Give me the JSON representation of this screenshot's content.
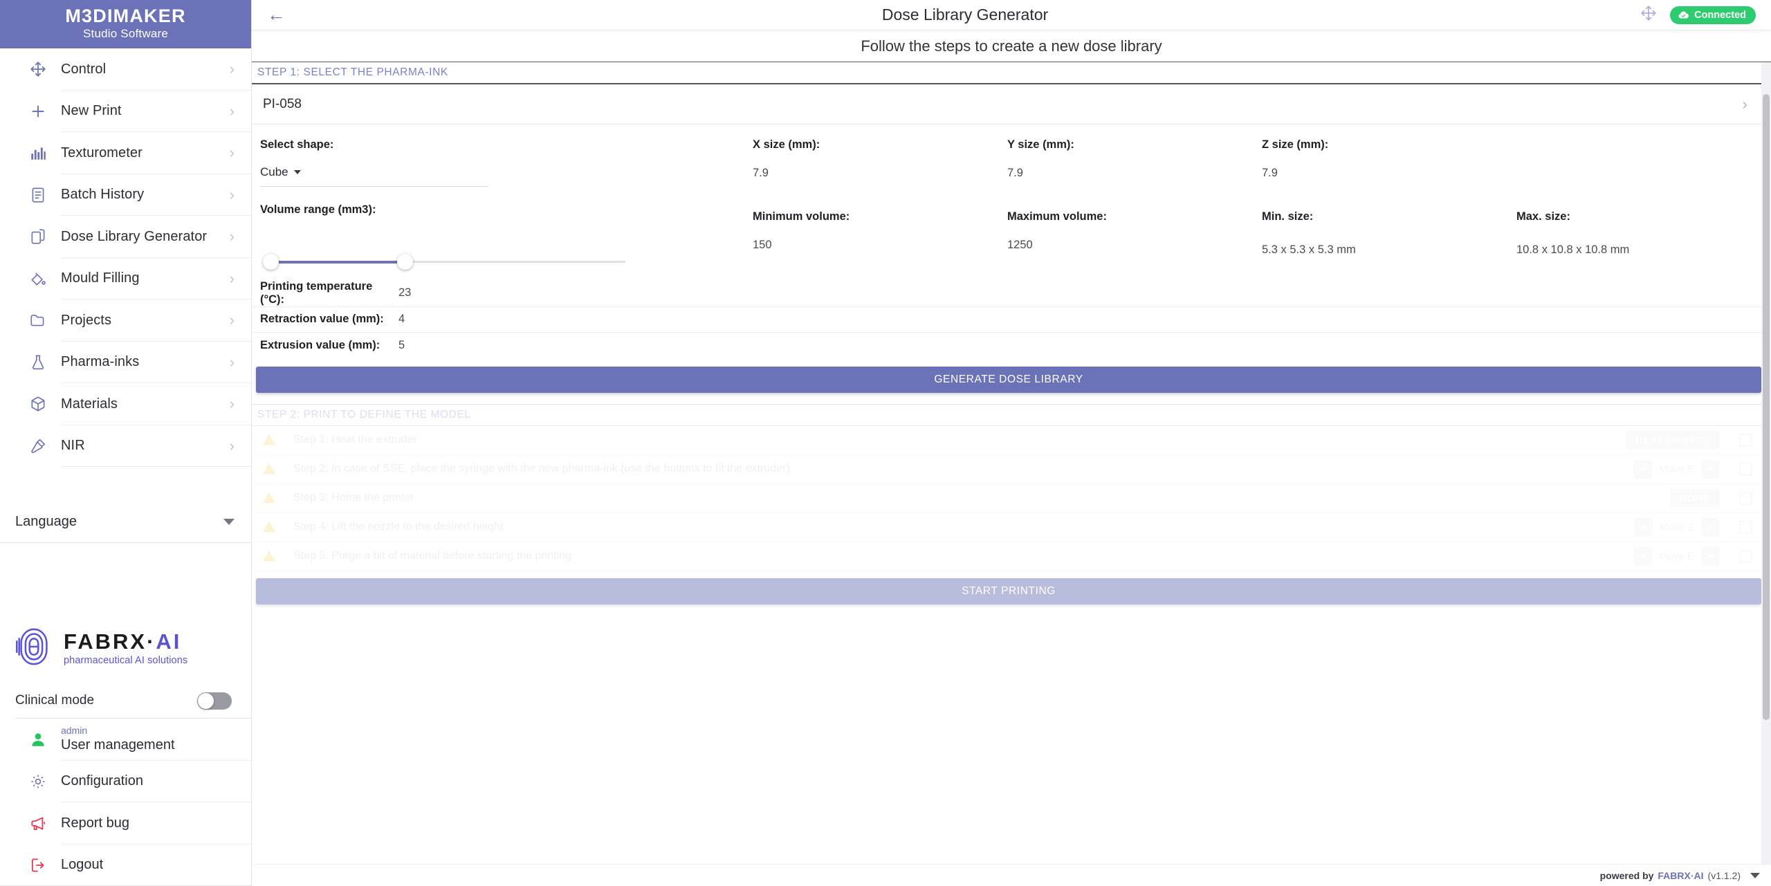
{
  "brand": {
    "title": "M3DIMAKER",
    "subtitle": "Studio Software"
  },
  "sidebar": {
    "items": [
      {
        "label": "Control",
        "icon": "move-icon"
      },
      {
        "label": "New Print",
        "icon": "plus-icon"
      },
      {
        "label": "Texturometer",
        "icon": "bar-chart-icon"
      },
      {
        "label": "Batch History",
        "icon": "document-icon"
      },
      {
        "label": "Dose Library Generator",
        "icon": "copy-files-icon"
      },
      {
        "label": "Mould Filling",
        "icon": "paint-bucket-icon"
      },
      {
        "label": "Projects",
        "icon": "folder-icon"
      },
      {
        "label": "Pharma-inks",
        "icon": "flask-icon"
      },
      {
        "label": "Materials",
        "icon": "cube-icon"
      },
      {
        "label": "NIR",
        "icon": "flashlight-icon"
      }
    ],
    "language_label": "Language",
    "logo": {
      "name_dark": "FABRX",
      "name_dot": "·",
      "name_accent": "AI",
      "tagline": "pharmaceutical AI solutions"
    },
    "clinical_mode": {
      "label": "Clinical mode",
      "enabled": false
    },
    "bottom_items": [
      {
        "sup": "admin",
        "label": "User management",
        "icon": "person-icon"
      },
      {
        "sup": "",
        "label": "Configuration",
        "icon": "gear-icon"
      },
      {
        "sup": "",
        "label": "Report bug",
        "icon": "megaphone-icon"
      },
      {
        "sup": "",
        "label": "Logout",
        "icon": "logout-icon"
      }
    ]
  },
  "header": {
    "back_label": "←",
    "title": "Dose Library Generator",
    "connection_status": "Connected",
    "subtitle": "Follow the steps to create a new dose library"
  },
  "step1": {
    "heading": "STEP 1: SELECT THE PHARMA-INK",
    "selected_ink": "PI-058",
    "fields": {
      "shape_label": "Select shape:",
      "shape_value": "Cube",
      "x_label": "X size (mm):",
      "x_value": "7.9",
      "y_label": "Y size (mm):",
      "y_value": "7.9",
      "z_label": "Z size (mm):",
      "z_value": "7.9",
      "volume_range_label": "Volume range (mm3):",
      "min_volume_label": "Minimum volume:",
      "min_volume_value": "150",
      "max_volume_label": "Maximum volume:",
      "max_volume_value": "1250",
      "min_size_label": "Min. size:",
      "min_size_value": "5.3 x 5.3 x 5.3 mm",
      "max_size_label": "Max. size:",
      "max_size_value": "10.8 x 10.8 x 10.8 mm"
    },
    "params": [
      {
        "label": "Printing temperature (°C):",
        "value": "23"
      },
      {
        "label": "Retraction value (mm):",
        "value": "4"
      },
      {
        "label": "Extrusion value (mm):",
        "value": "5"
      }
    ],
    "generate_button": "GENERATE DOSE LIBRARY"
  },
  "step2": {
    "heading": "STEP 2: PRINT TO DEFINE THE MODEL",
    "rows": [
      {
        "text": "Step 1: Heat the extruder",
        "control": "HEAT (39/23°C)",
        "control_type": "button"
      },
      {
        "text": "Step 2: In case of SSE, place the syringe with the new pharma-ink (use the buttons to fit the extruder).",
        "control": "Move E",
        "control_type": "stepper"
      },
      {
        "text": "Step 3: Home the printer",
        "control": "HOME",
        "control_type": "button"
      },
      {
        "text": "Step 4: Lift the nozzle to the desired height",
        "control": "Move Z",
        "control_type": "stepper"
      },
      {
        "text": "Step 5: Purge a bit of material before starting the printing",
        "control": "Move E",
        "control_type": "stepper"
      }
    ],
    "start_button": "START PRINTING"
  },
  "footer": {
    "powered_by": "powered by",
    "brand": "FABRX·AI",
    "version": "(v1.1.2)"
  },
  "colors": {
    "accent": "#6b72b8",
    "accent_light": "#b8bcdd",
    "success": "#2ecc71",
    "danger": "#e8374a"
  }
}
